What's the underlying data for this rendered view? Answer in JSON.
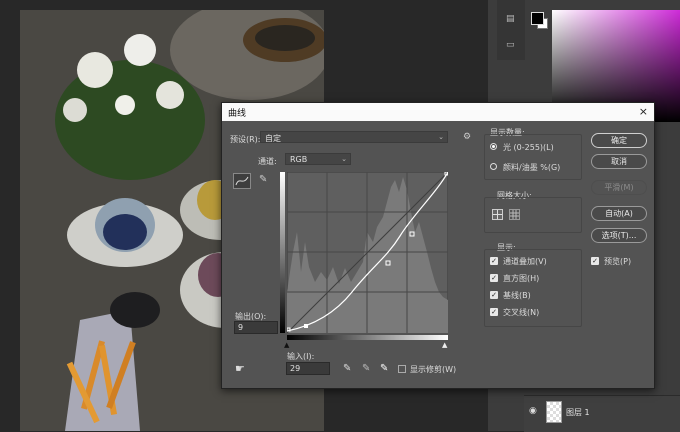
{
  "dialog": {
    "title": "曲线",
    "close_icon": "×",
    "preset_label": "预设(R):",
    "preset_value": "自定",
    "channel_label": "通道:",
    "channel_value": "RGB",
    "output_label": "输出(O):",
    "output_value": "9",
    "input_label": "输入(I):",
    "input_value": "29",
    "show_clipping_label": "显示修剪(W)",
    "display_amount": {
      "title": "显示数量:",
      "options": [
        "光 (0-255)(L)",
        "颜料/油墨 %(G)"
      ],
      "selected": 0
    },
    "grid_size": {
      "title": "网格大小:"
    },
    "show": {
      "title": "显示:",
      "items": [
        "通道叠加(V)",
        "直方图(H)",
        "基线(B)",
        "交叉线(N)"
      ]
    },
    "buttons": {
      "ok": "确定",
      "cancel": "取消",
      "smooth": "平滑(M)",
      "auto": "自动(A)",
      "options": "选项(T)..."
    },
    "preview_label": "预览(P)"
  },
  "layers": {
    "layer_name": "图层 1"
  },
  "colors": {
    "accent": "#ce2bd8",
    "dialog_bg": "#535353",
    "panel_bg": "#3c3c3c"
  }
}
